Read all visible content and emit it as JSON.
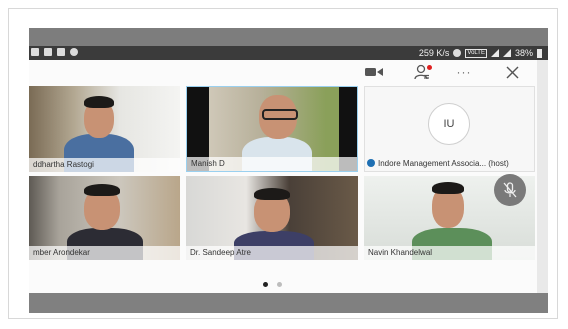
{
  "status_bar": {
    "speed": "259 K/s",
    "network": "VoLTE",
    "battery": "38%"
  },
  "toolbar": {
    "video_icon": "video-camera-icon",
    "participants_icon": "participants-icon",
    "more_label": "···",
    "close_icon": "close-icon"
  },
  "participants": [
    {
      "name": "ddhartha Rastogi"
    },
    {
      "name": "Manish D"
    },
    {
      "initials": "IU",
      "name": "Indore Management Associa... (host)"
    },
    {
      "name": "mber Arondekar"
    },
    {
      "name": "Dr. Sandeep Atre"
    },
    {
      "name": "Navin Khandelwal"
    }
  ],
  "pager": {
    "pages": 2,
    "current": 1
  },
  "colors": {
    "active_border": "#9ad0ef",
    "notification_dot": "#e02020",
    "host_icon": "#1e6fb3"
  }
}
